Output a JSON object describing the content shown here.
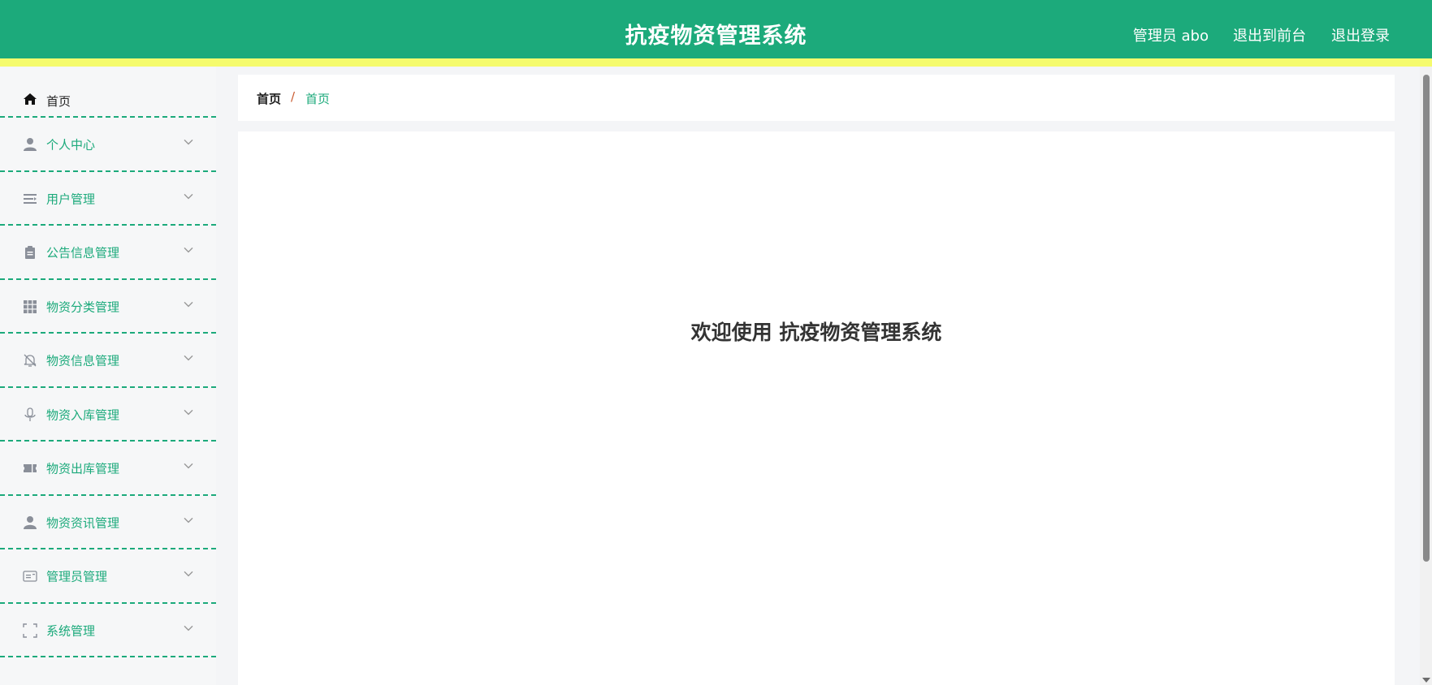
{
  "header": {
    "title": "抗疫物资管理系统",
    "user_label": "管理员 abo",
    "front_link": "退出到前台",
    "logout_link": "退出登录"
  },
  "sidebar": {
    "items": [
      {
        "label": "首页",
        "icon": "home-icon"
      },
      {
        "label": "个人中心",
        "icon": "user-icon"
      },
      {
        "label": "用户管理",
        "icon": "list-icon"
      },
      {
        "label": "公告信息管理",
        "icon": "clipboard-icon"
      },
      {
        "label": "物资分类管理",
        "icon": "grid-icon"
      },
      {
        "label": "物资信息管理",
        "icon": "bell-off-icon"
      },
      {
        "label": "物资入库管理",
        "icon": "microphone-icon"
      },
      {
        "label": "物资出库管理",
        "icon": "ticket-icon"
      },
      {
        "label": "物资资讯管理",
        "icon": "person-icon"
      },
      {
        "label": "管理员管理",
        "icon": "id-card-icon"
      },
      {
        "label": "系统管理",
        "icon": "fullscreen-icon"
      }
    ]
  },
  "breadcrumb": {
    "home": "首页",
    "separator": "/",
    "current": "首页"
  },
  "main": {
    "welcome": "欢迎使用 抗疫物资管理系统"
  },
  "colors": {
    "primary": "#1caa7b",
    "header_border": "#f5fb6d",
    "separator": "#c95a2f"
  }
}
